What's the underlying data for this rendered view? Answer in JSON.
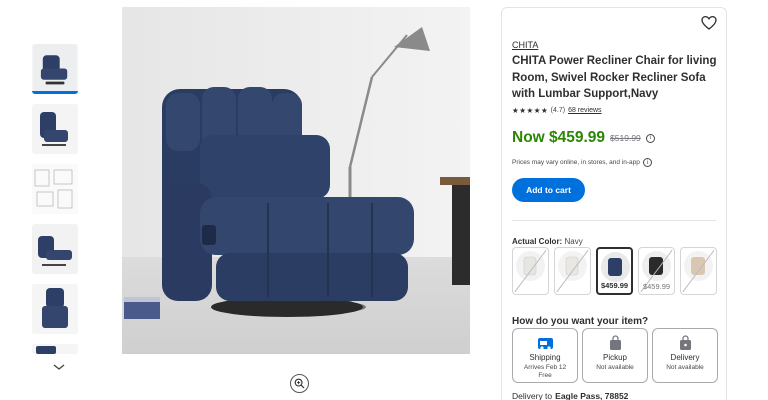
{
  "product": {
    "brand": "CHITA",
    "title": "CHITA Power Recliner Chair for living Room, Swivel Rocker Recliner Sofa with Lumbar Support,Navy",
    "rating_value": "(4.7)",
    "reviews_link": "68 reviews",
    "price_now": "Now $459.99",
    "price_was": "$519.99",
    "disclaimer": "Prices may vary online, in stores, and in-app",
    "add_to_cart": "Add to cart"
  },
  "color": {
    "label": "Actual Color:",
    "value": "Navy",
    "swatches": [
      {
        "name": "white",
        "price": "",
        "available": false,
        "selected": false
      },
      {
        "name": "cream",
        "price": "",
        "available": false,
        "selected": false
      },
      {
        "name": "navy",
        "price": "$459.99",
        "available": true,
        "selected": true
      },
      {
        "name": "black",
        "price": "$459.99",
        "available": false,
        "selected": false
      },
      {
        "name": "beige",
        "price": "",
        "available": false,
        "selected": false
      }
    ]
  },
  "fulfillment": {
    "heading": "How do you want your item?",
    "options": [
      {
        "name": "Shipping",
        "line1": "Arrives Feb 12",
        "line2": "Free",
        "icon": "truck-icon"
      },
      {
        "name": "Pickup",
        "line1": "Not available",
        "line2": "",
        "icon": "store-bag-icon"
      },
      {
        "name": "Delivery",
        "line1": "Not available",
        "line2": "",
        "icon": "delivery-bag-icon"
      }
    ]
  },
  "delivery": {
    "label": "Delivery to",
    "location": "Eagle Pass, 78852"
  },
  "colors": {
    "accent": "#0071dc",
    "price_green": "#2a8703",
    "chair_navy": "#2d3f66"
  }
}
